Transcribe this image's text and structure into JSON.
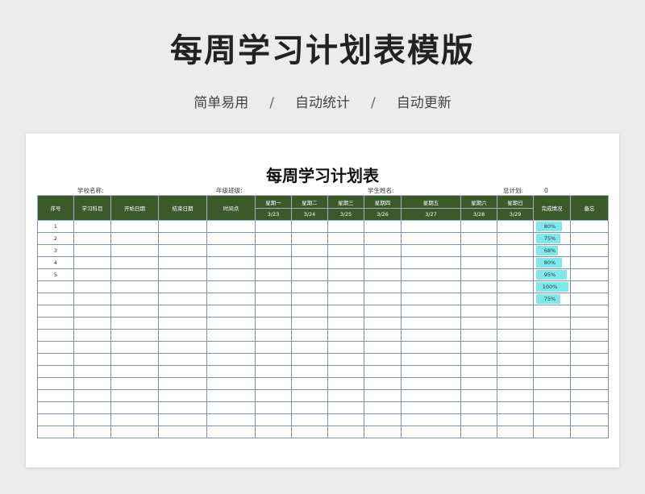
{
  "hero": {
    "title": "每周学习计划表模版",
    "features": [
      "简单易用",
      "自动统计",
      "自动更新"
    ],
    "separator": "/"
  },
  "sheet": {
    "title": "每周学习计划表",
    "school_label": "学校名称:",
    "grade_label": "年级班级:",
    "student_label": "学生姓名:",
    "total_label": "总计划:",
    "total_value": "0",
    "headers": {
      "index": "序号",
      "subject": "学习科目",
      "start": "开始日期",
      "end": "结束日期",
      "time": "时间点",
      "days": [
        {
          "name": "星期一",
          "date": "3/23"
        },
        {
          "name": "星期二",
          "date": "3/24"
        },
        {
          "name": "星期三",
          "date": "3/25"
        },
        {
          "name": "星期四",
          "date": "3/26"
        },
        {
          "name": "星期五",
          "date": "3/27"
        },
        {
          "name": "星期六",
          "date": "3/28"
        },
        {
          "name": "星期日",
          "date": "3/29"
        }
      ],
      "completion": "完成情况",
      "notes": "备忘"
    },
    "rows": [
      {
        "index": "1",
        "completion": 0.8,
        "completion_label": "80%"
      },
      {
        "index": "2",
        "completion": 0.75,
        "completion_label": "75%"
      },
      {
        "index": "3",
        "completion": 0.68,
        "completion_label": "68%"
      },
      {
        "index": "4",
        "completion": 0.8,
        "completion_label": "80%"
      },
      {
        "index": "5",
        "completion": 0.95,
        "completion_label": "95%"
      },
      {
        "index": "",
        "completion": 1.0,
        "completion_label": "100%"
      },
      {
        "index": "",
        "completion": 0.75,
        "completion_label": "75%"
      }
    ],
    "empty_rows": 11
  }
}
